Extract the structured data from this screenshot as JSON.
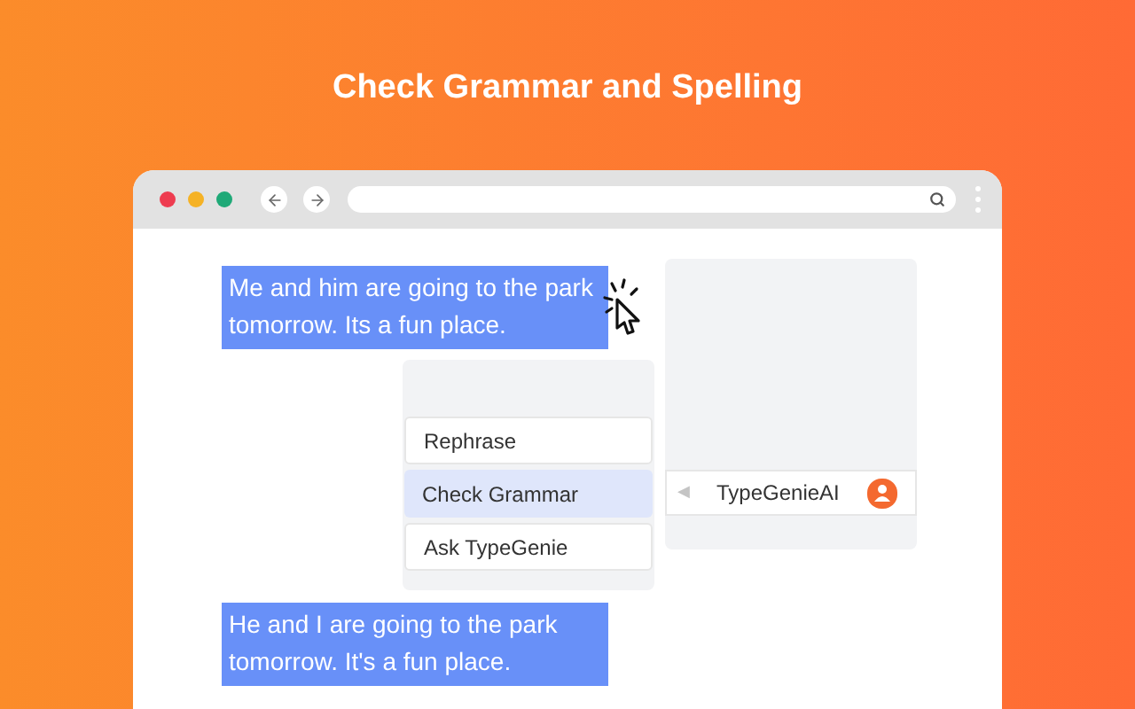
{
  "headline": "Check Grammar and Spelling",
  "selected_text": "Me and him are going to the park tomorrow. Its a fun place.",
  "menu": [
    {
      "label": "Rephrase",
      "selected": false
    },
    {
      "label": "Check Grammar",
      "selected": true
    },
    {
      "label": "Ask TypeGenie",
      "selected": false
    }
  ],
  "extension": {
    "arrow": "◀",
    "name": "TypeGenieAI"
  },
  "corrected_text": "He and I are going to the park tomorrow. It's a fun place."
}
